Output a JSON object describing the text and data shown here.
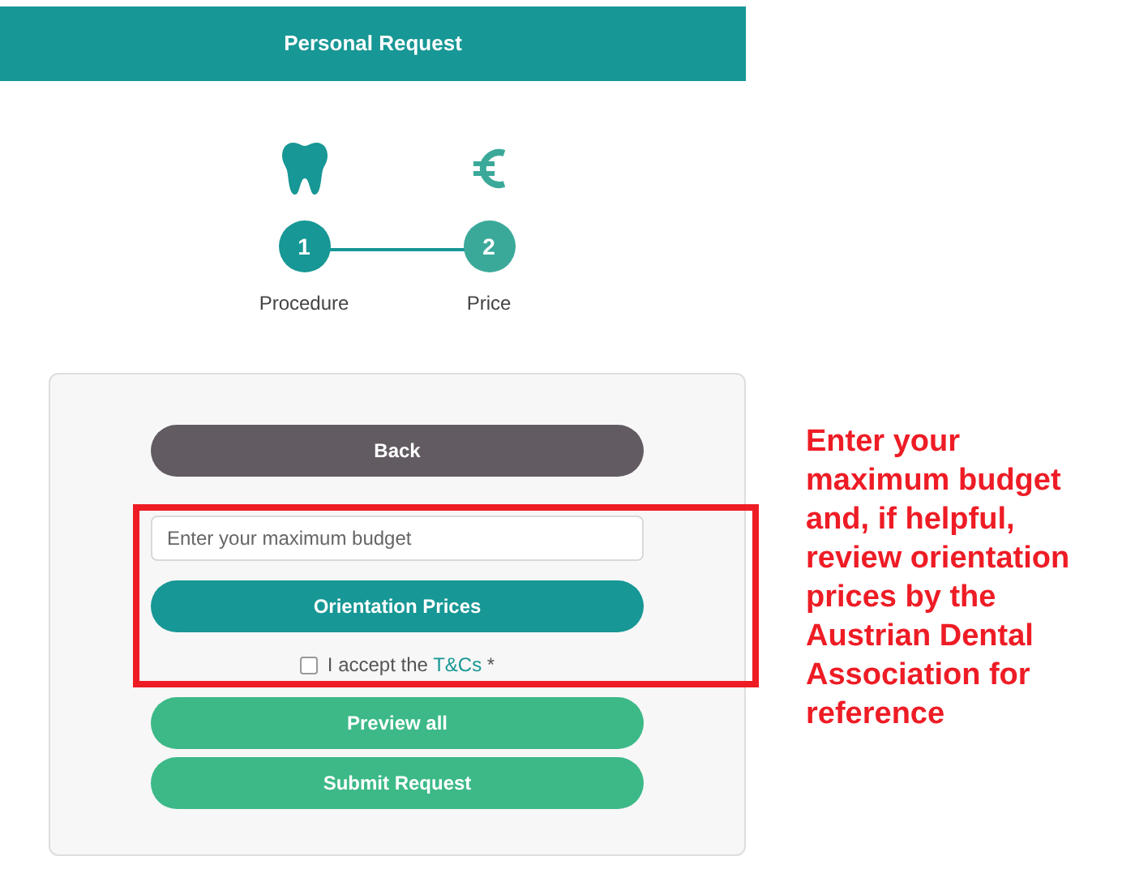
{
  "header": {
    "title": "Personal Request"
  },
  "steps": [
    {
      "kind": "tooth",
      "number": "1",
      "label": "Procedure",
      "active": true
    },
    {
      "kind": "euro",
      "number": "2",
      "label": "Price",
      "active": false
    }
  ],
  "form": {
    "back_button": "Back",
    "budget_field": {
      "placeholder": "Enter your maximum budget"
    },
    "orientation_button": "Orientation Prices",
    "terms": {
      "checked": false,
      "text": "I accept the ",
      "link": "T&Cs",
      "required_mark": "*"
    },
    "preview_button": "Preview all",
    "submit_button": "Submit Request"
  },
  "annotation": {
    "text": "Enter your maximum budget and, if helpful, review orientation prices by the Austrian Dental Association for reference"
  }
}
